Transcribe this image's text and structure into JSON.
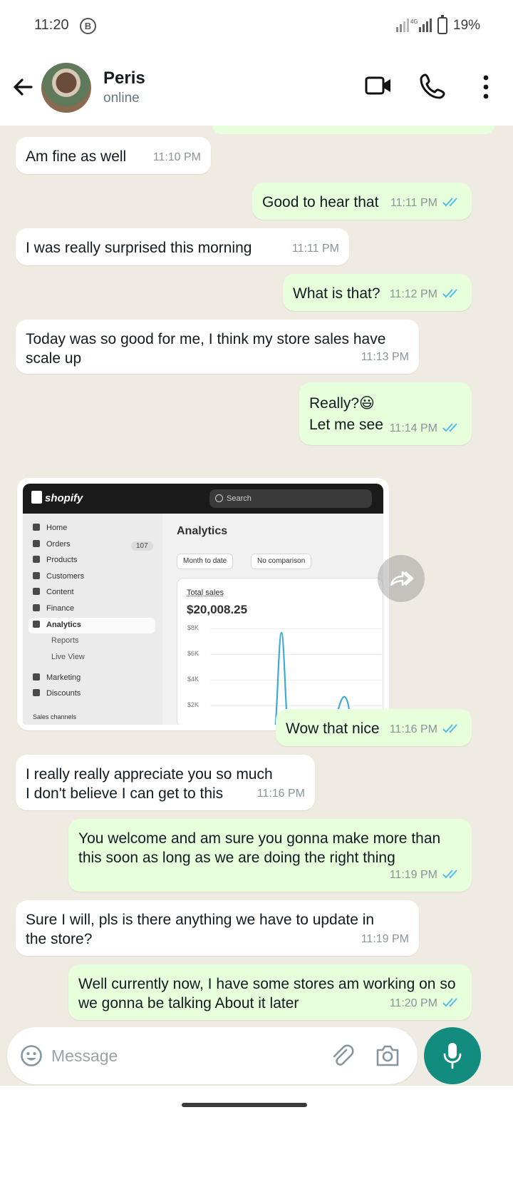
{
  "status_bar": {
    "time": "11:20",
    "badge": "B",
    "battery": "19%"
  },
  "header": {
    "contact_name": "Peris",
    "status": "online"
  },
  "messages": [
    {
      "text": "Am fine as well",
      "time": "11:10 PM"
    },
    {
      "text": "Good to hear that",
      "time": "11:11 PM"
    },
    {
      "text": "I was really surprised this morning",
      "time": "11:11 PM"
    },
    {
      "text": "What is that?",
      "time": "11:12 PM"
    },
    {
      "text": "Today was so good for me, I think my store sales have scale up",
      "time": "11:13 PM"
    },
    {
      "text": "Really?😃",
      "text2": "Let me see",
      "time": "11:14 PM"
    },
    {
      "text": "Wow that nice",
      "time": "11:16 PM"
    },
    {
      "text": "I really really appreciate you so much",
      "text2": "I don't believe I can get to this",
      "time": "11:16 PM"
    },
    {
      "text": "You welcome and am sure you gonna make more than this soon as long as we are doing the right thing",
      "time": "11:19 PM"
    },
    {
      "text": "Sure I will, pls is there anything we have to update in the store?",
      "time": "11:19 PM"
    },
    {
      "text": "Well currently now, I have some stores am working on so we gonna be talking About it later",
      "time": "11:20 PM"
    }
  ],
  "shared_image": {
    "brand": "shopify",
    "search_placeholder": "Search",
    "nav": [
      "Home",
      "Orders",
      "Products",
      "Customers",
      "Content",
      "Finance",
      "Analytics",
      "Reports",
      "Live View",
      "Marketing",
      "Discounts",
      "Sales channels"
    ],
    "orders_count": "107",
    "page_title": "Analytics",
    "chip_period": "Month to date",
    "chip_compare": "No comparison",
    "card_label": "Total sales",
    "card_value": "$20,008.25",
    "ticks": [
      "$8K",
      "$6K",
      "$4K",
      "$2K"
    ]
  },
  "composer": {
    "placeholder": "Message"
  },
  "colors": {
    "outgoing_bubble": "#e7ffdb",
    "incoming_bubble": "#ffffff",
    "chat_background": "#efeae2",
    "read_ticks": "#53bdeb",
    "mic_button": "#128c7e"
  }
}
